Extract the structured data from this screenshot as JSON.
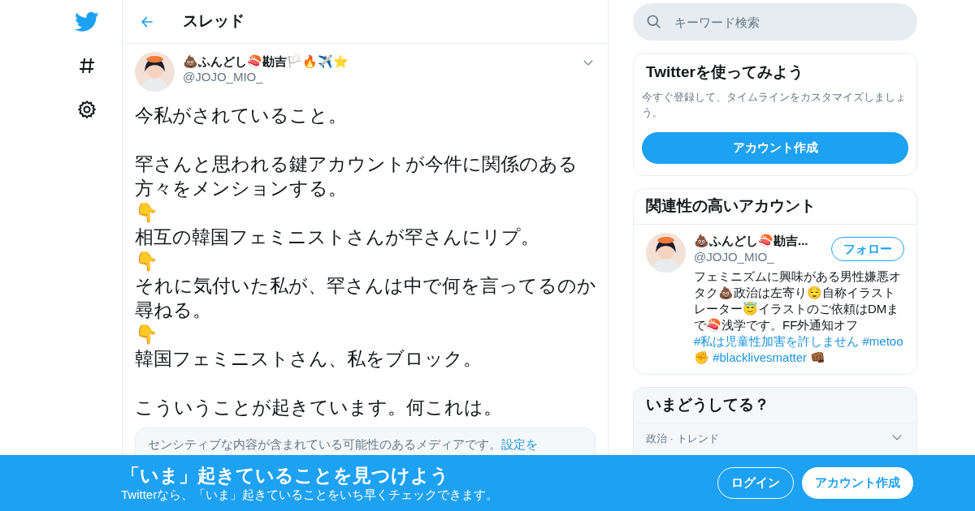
{
  "nav": {
    "items": [
      {
        "kind": "logo"
      },
      {
        "kind": "explore"
      },
      {
        "kind": "settings"
      }
    ]
  },
  "header": {
    "title": "スレッド"
  },
  "tweet": {
    "name": "💩ふんどし🍣勘吉🏳️🔥✈️⭐",
    "handle": "@JOJO_MIO_",
    "paragraphs": [
      [
        "今私がされていること。"
      ],
      [
        "罕さんと思われる鍵アカウントが今件に関係のある方々をメンションする。",
        "👇",
        "相互の韓国フェミニストさんが罕さんにリプ。",
        "👇",
        "それに気付いた私が、罕さんは中で何を言ってるのか尋ねる。",
        "👇",
        "韓国フェミニストさん、私をブロック。"
      ],
      [
        "こういうことが起きています。何これは。"
      ]
    ],
    "sensitive": {
      "text": "センシティブな内容が含まれている可能性のあるメディアです。",
      "link": "設定を"
    }
  },
  "search": {
    "placeholder": "キーワード検索"
  },
  "signup_card": {
    "title": "Twitterを使ってみよう",
    "text": "今すぐ登録して、タイムラインをカスタマイズしましょう。",
    "button": "アカウント作成"
  },
  "related": {
    "title": "関連性の高いアカウント",
    "accounts": [
      {
        "name": "💩ふんどし🍣勘吉...",
        "handle": "@JOJO_MIO_",
        "follow": "フォロー",
        "bio": [
          {
            "kind": "text",
            "text": "フェミニズムに興味がある男性嫌悪オタク💩政治は左寄り😌自称イラストレーター😇イラストのご依頼はDMまで🍣浅学です。FF外通知オフ"
          },
          {
            "kind": "hashtag",
            "text": "#私は児童性加害を許しません"
          },
          {
            "kind": "hashtag",
            "text": "#metoo"
          },
          {
            "kind": "text",
            "text": "✊"
          },
          {
            "kind": "hashtag",
            "text": "#blacklivesmatter"
          },
          {
            "kind": "text",
            "text": "👊🏾"
          }
        ]
      }
    ]
  },
  "trends": {
    "title": "いまどうしてる？",
    "items": [
      {
        "category": "政治 · トレンド"
      }
    ]
  },
  "banner": {
    "title": "「いま」起きていることを見つけよう",
    "subtitle": "Twitterなら、「いま」起きていることをいち早くチェックできます。",
    "buttons": [
      {
        "kind": "outline",
        "label": "ログイン"
      },
      {
        "kind": "solid",
        "label": "アカウント作成"
      }
    ]
  }
}
